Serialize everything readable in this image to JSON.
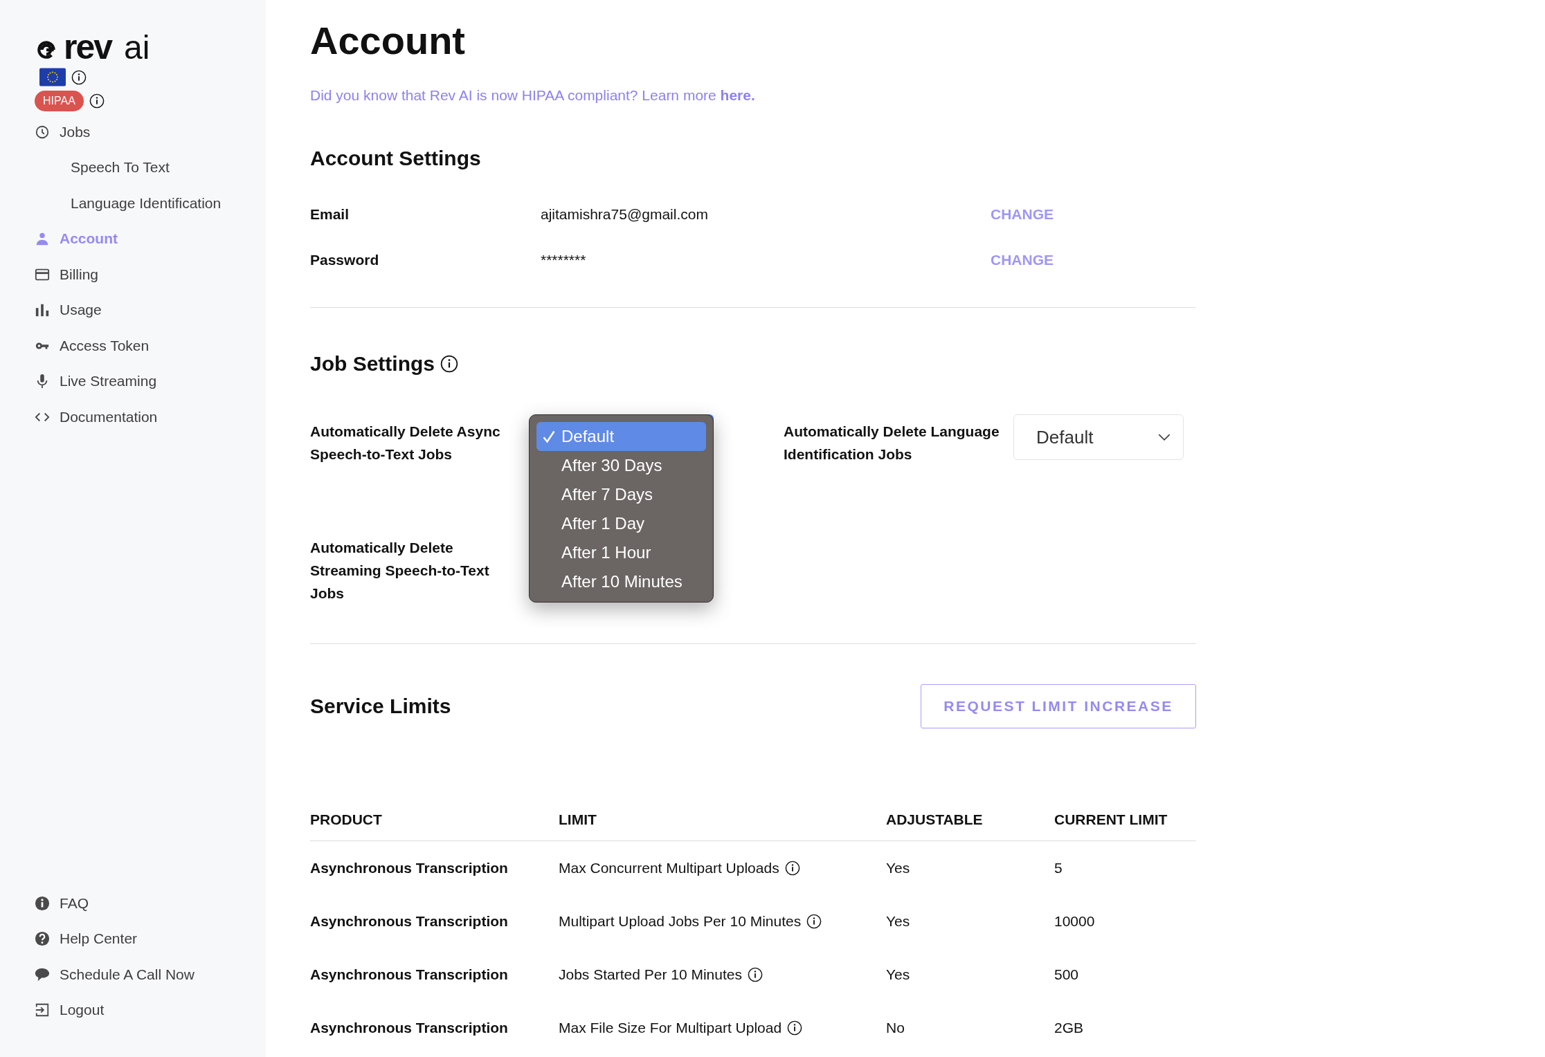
{
  "sidebar": {
    "logo": {
      "bold_part": "rev",
      "light_part": "ai"
    },
    "hipaa_badge": "HIPAA",
    "nav": [
      {
        "label": "Jobs",
        "selected": false,
        "children": [
          {
            "label": "Speech To Text",
            "selected": false
          },
          {
            "label": "Language Identification",
            "selected": false
          }
        ]
      },
      {
        "label": "Account",
        "selected": true
      },
      {
        "label": "Billing",
        "selected": false
      },
      {
        "label": "Usage",
        "selected": false
      },
      {
        "label": "Access Token",
        "selected": false
      },
      {
        "label": "Live Streaming",
        "selected": false
      },
      {
        "label": "Documentation",
        "selected": false
      }
    ],
    "footer_nav": [
      {
        "label": "FAQ"
      },
      {
        "label": "Help Center"
      },
      {
        "label": "Schedule A Call Now"
      },
      {
        "label": "Logout"
      }
    ]
  },
  "main": {
    "title": "Account",
    "notice": {
      "text": "Did you know that Rev AI is now HIPAA compliant? Learn more",
      "link": "here."
    },
    "account_settings": {
      "title": "Account Settings",
      "rows": [
        {
          "label": "Email",
          "value": "ajitamishra75@gmail.com",
          "action": "CHANGE"
        },
        {
          "label": "Password",
          "value": "********",
          "action": "CHANGE"
        }
      ]
    },
    "job_settings": {
      "title": "Job Settings",
      "fields": [
        {
          "label": "Automatically Delete Async Speech-to-Text Jobs",
          "open": true,
          "options": [
            {
              "label": "Default",
              "selected": true
            },
            {
              "label": "After 30 Days",
              "selected": false
            },
            {
              "label": "After 7 Days",
              "selected": false
            },
            {
              "label": "After 1 Day",
              "selected": false
            },
            {
              "label": "After 1 Hour",
              "selected": false
            },
            {
              "label": "After 10 Minutes",
              "selected": false
            }
          ]
        },
        {
          "label": "Automatically Delete Language Identification Jobs",
          "open": false,
          "value": "Default"
        },
        {
          "label": "Automatically Delete Streaming Speech-to-Text Jobs"
        }
      ]
    },
    "service_limits": {
      "title": "Service Limits",
      "button": "REQUEST LIMIT INCREASE",
      "table": {
        "columns": [
          "PRODUCT",
          "LIMIT",
          "ADJUSTABLE",
          "CURRENT LIMIT"
        ],
        "rows": [
          [
            "Asynchronous Transcription",
            "Max Concurrent Multipart Uploads",
            "Yes",
            "5"
          ],
          [
            "Asynchronous Transcription",
            "Multipart Upload Jobs Per 10 Minutes",
            "Yes",
            "10000"
          ],
          [
            "Asynchronous Transcription",
            "Jobs Started Per 10 Minutes",
            "Yes",
            "500"
          ],
          [
            "Asynchronous Transcription",
            "Max File Size For Multipart Upload",
            "No",
            "2GB"
          ]
        ]
      }
    }
  }
}
